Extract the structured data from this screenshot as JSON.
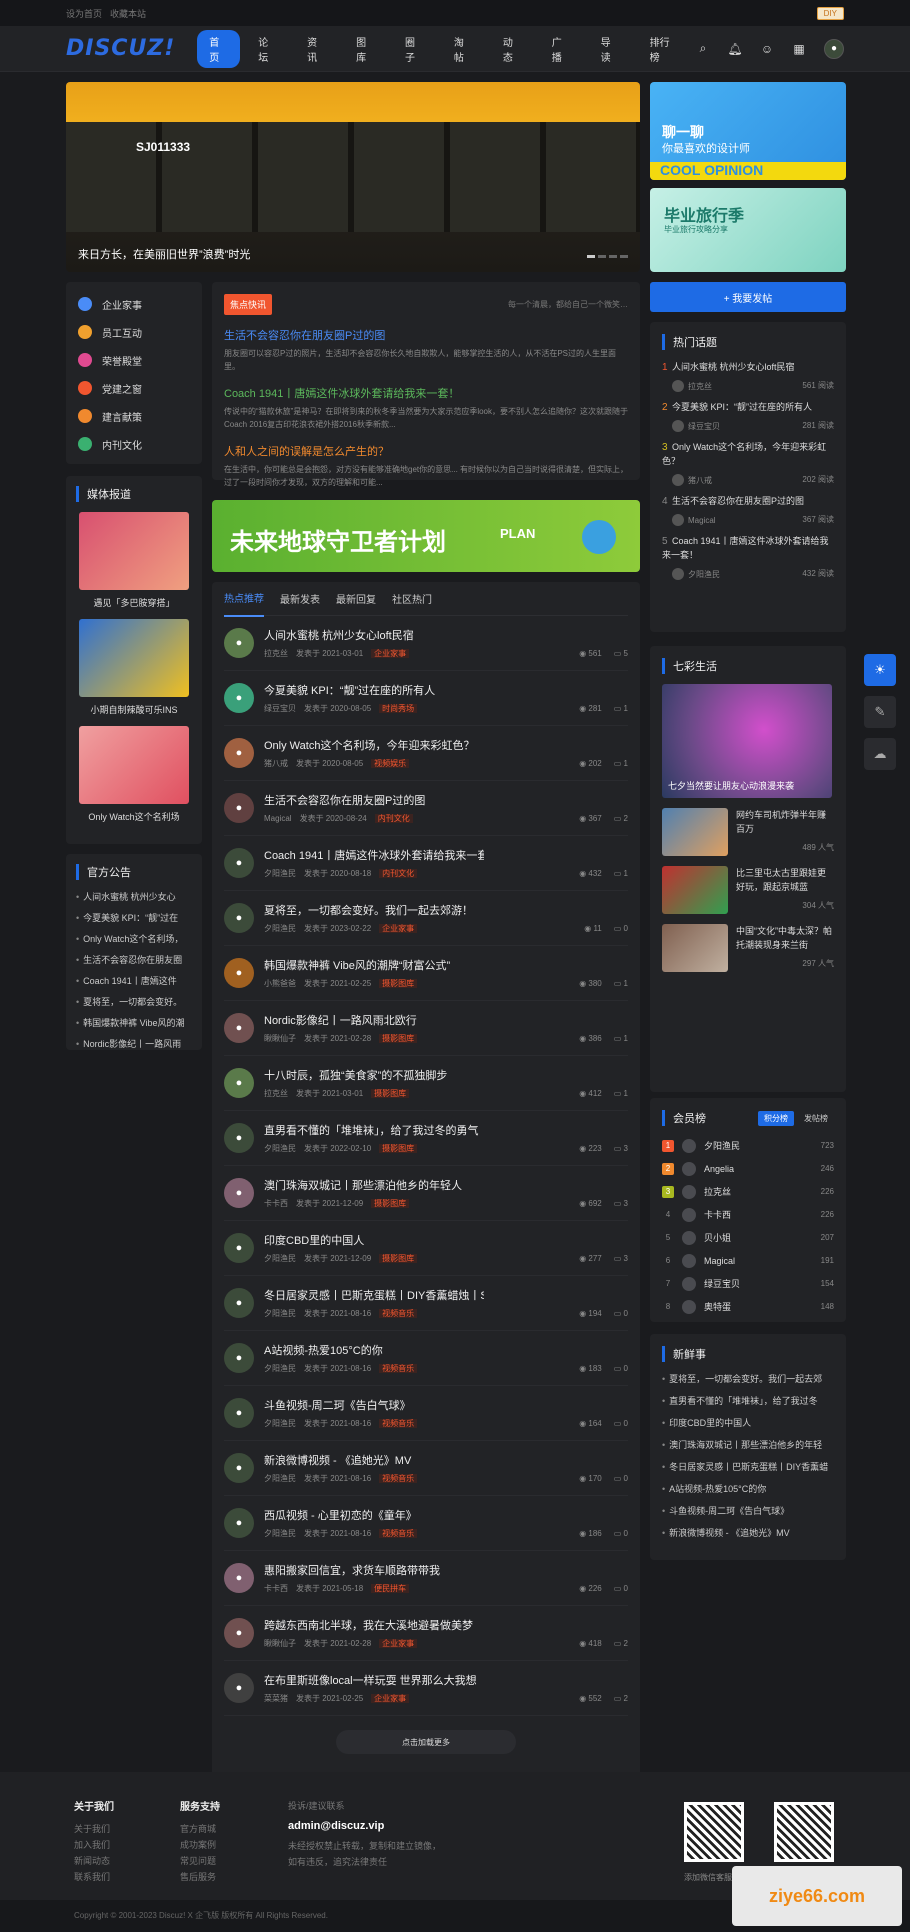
{
  "topbar": {
    "home": "设为首页",
    "fav": "收藏本站",
    "diy": "DIY"
  },
  "nav": {
    "logo": "DISCUZ!",
    "items": [
      "首页",
      "论坛",
      "资讯",
      "图库",
      "圈子",
      "淘帖",
      "动态",
      "广播",
      "导读",
      "排行榜"
    ]
  },
  "slider": {
    "plate": "SJ011333",
    "caption": "来日方长，在美丽旧世界”浪费”时光"
  },
  "ads": {
    "ad1_t1": "聊一聊",
    "ad1_t2": "你最喜欢的设计师",
    "ad1_t3": "COOL OPINION",
    "ad2_t1": "毕业旅行季",
    "ad2_t2": "毕业旅行攻略分享"
  },
  "cats": [
    "企业家事",
    "员工互动",
    "荣誉殿堂",
    "党建之窗",
    "建言献策",
    "内刊文化"
  ],
  "hot": {
    "badge": "焦点快讯",
    "right": "每一个清晨，都给自己一个微笑…",
    "items": [
      {
        "t": "生活不会容忍你在朋友圈P过的图",
        "d": "朋友圈可以容忍P过的照片，生活却不会容忍你长久地自欺欺人，能够掌控生活的人，从不活在PS过的人生里面里。",
        "c": "#4a8cf7"
      },
      {
        "t": "Coach 1941丨唐嫣这件冰球外套请给我来一套！",
        "d": "传说中的“猫款休旅”是神马？在即将到来的秋冬季当然要为大家示范应季look，要不别人怎么追随你？这次就跟随于Coach 2016复古印花浪衣裙外搭2016秋季新款...",
        "c": "#5cb85c"
      },
      {
        "t": "人和人之间的误解是怎么产生的？",
        "d": "在生活中，你可能总是会抱怨，对方没有能够准确地get你的意思... 有时候你以为自己当时说得很清楚，但实际上，过了一段时间你才发现，双方的理解和可能...",
        "c": "#f0892e"
      }
    ]
  },
  "media": {
    "title": "媒体报道",
    "items": [
      "遇见「多巴胺穿搭」",
      "小期自制辣酸可乐INS",
      "Only Watch这个名利场"
    ]
  },
  "banner": {
    "t": "未来地球守卫者计划",
    "s": "PLAN"
  },
  "notice": {
    "title": "官方公告",
    "items": [
      "人间水蜜桃 杭州少女心",
      "今夏美貌 KPI：“靓”过在",
      "Only Watch这个名利场，",
      "生活不会容忍你在朋友圈",
      "Coach 1941丨唐嫣这件",
      "夏将至，一切都会变好。",
      "韩国爆款神裤 Vibe风的潮",
      "Nordic影像纪丨一路风雨"
    ]
  },
  "tabs": [
    "热点推荐",
    "最新发表",
    "最新回复",
    "社区热门"
  ],
  "threads": [
    {
      "t": "人间水蜜桃 杭州少女心loft民宿",
      "u": "拉克丝",
      "d": "发表于 2021-03-01",
      "tag": "企业家事",
      "v": "561",
      "r": "5",
      "c": "#5a7a4a"
    },
    {
      "t": "今夏美貌 KPI：“靓”过在座的所有人",
      "u": "绿豆宝贝",
      "d": "发表于 2020-08-05",
      "tag": "时尚秀场",
      "v": "281",
      "r": "1",
      "c": "#3aa07a"
    },
    {
      "t": "Only Watch这个名利场，今年迎来彩虹色？",
      "u": "猪八戒",
      "d": "发表于 2020-08-05",
      "tag": "视频娱乐",
      "v": "202",
      "r": "1",
      "c": "#a06040"
    },
    {
      "t": "生活不会容忍你在朋友圈P过的图",
      "u": "Magical",
      "d": "发表于 2020-08-24",
      "tag": "内刊文化",
      "v": "367",
      "r": "2",
      "c": "#604040"
    },
    {
      "t": "Coach 1941丨唐嫣这件冰球外套请给我来一套",
      "u": "夕阳渔民",
      "d": "发表于 2020-08-18",
      "tag": "内刊文化",
      "v": "432",
      "r": "1",
      "c": "#3c4b3a"
    },
    {
      "t": "夏将至，一切都会变好。我们一起去郊游！",
      "u": "夕阳渔民",
      "d": "发表于 2023-02-22",
      "tag": "企业家事",
      "v": "11",
      "r": "0",
      "c": "#3c4b3a"
    },
    {
      "t": "韩国爆款神裤 Vibe风的潮牌“财富公式”",
      "u": "小熊爸爸",
      "d": "发表于 2021-02-25",
      "tag": "摄影图库",
      "v": "380",
      "r": "1",
      "c": "#a06020"
    },
    {
      "t": "Nordic影像纪丨一路风雨北欧行",
      "u": "瞅瞅仙子",
      "d": "发表于 2021-02-28",
      "tag": "摄影图库",
      "v": "386",
      "r": "1",
      "c": "#705050"
    },
    {
      "t": "十八时辰，孤独“美食家”的不孤独脚步",
      "u": "拉克丝",
      "d": "发表于 2021-03-01",
      "tag": "摄影图库",
      "v": "412",
      "r": "1",
      "c": "#5a7a4a"
    },
    {
      "t": "直男看不懂的「堆堆袜」，给了我过冬的勇气",
      "u": "夕阳渔民",
      "d": "发表于 2022-02-10",
      "tag": "摄影图库",
      "v": "223",
      "r": "3",
      "c": "#3c4b3a"
    },
    {
      "t": "澳门珠海双城记丨那些漂泊他乡的年轻人",
      "u": "卡卡西",
      "d": "发表于 2021-12-09",
      "tag": "摄影图库",
      "v": "692",
      "r": "3",
      "c": "#806070"
    },
    {
      "t": "印度CBD里的中国人",
      "u": "夕阳渔民",
      "d": "发表于 2021-12-09",
      "tag": "摄影图库",
      "v": "277",
      "r": "3",
      "c": "#3c4b3a"
    },
    {
      "t": "冬日居家灵感丨巴斯克蛋糕丨DIY香薰蜡烛丨S",
      "u": "夕阳渔民",
      "d": "发表于 2021-08-16",
      "tag": "视频音乐",
      "v": "194",
      "r": "0",
      "c": "#3c4b3a"
    },
    {
      "t": "A站视频-热爱105°C的你",
      "u": "夕阳渔民",
      "d": "发表于 2021-08-16",
      "tag": "视频音乐",
      "v": "183",
      "r": "0",
      "c": "#3c4b3a"
    },
    {
      "t": "斗鱼视频-周二珂《告白气球》",
      "u": "夕阳渔民",
      "d": "发表于 2021-08-16",
      "tag": "视频音乐",
      "v": "164",
      "r": "0",
      "c": "#3c4b3a"
    },
    {
      "t": "新浪微博视频 - 《追她光》MV",
      "u": "夕阳渔民",
      "d": "发表于 2021-08-16",
      "tag": "视频音乐",
      "v": "170",
      "r": "0",
      "c": "#3c4b3a"
    },
    {
      "t": "西瓜视频 - 心里初恋的《童年》",
      "u": "夕阳渔民",
      "d": "发表于 2021-08-16",
      "tag": "视频音乐",
      "v": "186",
      "r": "0",
      "c": "#3c4b3a"
    },
    {
      "t": "惠阳搬家回信宜，求货车顺路带带我",
      "u": "卡卡西",
      "d": "发表于 2021-05-18",
      "tag": "便民拼车",
      "v": "226",
      "r": "0",
      "c": "#806070"
    },
    {
      "t": "跨越东西南北半球，我在大溪地避暑做美梦",
      "u": "瞅瞅仙子",
      "d": "发表于 2021-02-28",
      "tag": "企业家事",
      "v": "418",
      "r": "2",
      "c": "#705050"
    },
    {
      "t": "在布里斯班像local一样玩耍 世界那么大我想",
      "u": "菜菜猪",
      "d": "发表于 2021-02-25",
      "tag": "企业家事",
      "v": "552",
      "r": "2",
      "c": "#404040"
    }
  ],
  "more": "点击加载更多",
  "post": "+ 我要发帖",
  "hottopic": {
    "title": "热门话题",
    "items": [
      {
        "n": "1",
        "t": "人间水蜜桃 杭州少女心loft民宿",
        "u": "拉克丝",
        "v": "561 阅读",
        "c": "#f1562f"
      },
      {
        "n": "2",
        "t": "今夏美貌 KPI：“靓”过在座的所有人",
        "u": "绿豆宝贝",
        "v": "281 阅读",
        "c": "#f0892e"
      },
      {
        "n": "3",
        "t": "Only Watch这个名利场，今年迎来彩虹色？",
        "u": "猪八戒",
        "v": "202 阅读",
        "c": "#d5c020"
      },
      {
        "n": "4",
        "t": "生活不会容忍你在朋友圈P过的图",
        "u": "Magical",
        "v": "367 阅读",
        "c": "#888"
      },
      {
        "n": "5",
        "t": "Coach 1941丨唐嫣这件冰球外套请给我来一套！",
        "u": "夕阳渔民",
        "v": "432 阅读",
        "c": "#888"
      }
    ]
  },
  "life": {
    "title": "七彩生活",
    "big": "七夕当然要让朋友心动浪漫来袭",
    "items": [
      {
        "t": "网约车司机炸弹半年赚百万",
        "p": "489 人气"
      },
      {
        "t": "比三里屯太古里跟娃更好玩，跟起京城蓝",
        "p": "304 人气"
      },
      {
        "t": "中国“文化”中毒太深？帕托潮装现身来兰街",
        "p": "297 人气"
      }
    ]
  },
  "rank": {
    "title": "会员榜",
    "b1": "积分榜",
    "b2": "发帖榜",
    "items": [
      {
        "n": "1",
        "u": "夕阳渔民",
        "v": "723",
        "c": "#f1562f"
      },
      {
        "n": "2",
        "u": "Angelia",
        "v": "246",
        "c": "#f0892e"
      },
      {
        "n": "3",
        "u": "拉克丝",
        "v": "226",
        "c": "#a8b820"
      },
      {
        "n": "4",
        "u": "卡卡西",
        "v": "226",
        "c": ""
      },
      {
        "n": "5",
        "u": "贝小姐",
        "v": "207",
        "c": ""
      },
      {
        "n": "6",
        "u": "Magical",
        "v": "191",
        "c": ""
      },
      {
        "n": "7",
        "u": "绿豆宝贝",
        "v": "154",
        "c": ""
      },
      {
        "n": "8",
        "u": "奥特蛋",
        "v": "148",
        "c": ""
      }
    ]
  },
  "fresh": {
    "title": "新鲜事",
    "items": [
      "夏将至，一切都会变好。我们一起去郊",
      "直男看不懂的「堆堆袜」，给了我过冬",
      "印度CBD里的中国人",
      "澳门珠海双城记丨那些漂泊他乡的年轻",
      "冬日居家灵感丨巴斯克蛋糕丨DIY香薰蜡",
      "A站视频-热爱105°C的你",
      "斗鱼视频-周二珂《告白气球》",
      "新浪微博视频 - 《追她光》MV"
    ]
  },
  "footer": {
    "c1": "关于我们",
    "c1i": [
      "关于我们",
      "加入我们",
      "新闻动态",
      "联系我们"
    ],
    "c2": "服务支持",
    "c2i": [
      "官方商城",
      "成功案例",
      "常见问题",
      "售后服务"
    ],
    "c3": "投诉/建议联系",
    "email": "admin@discuz.vip",
    "note1": "未经授权禁止转载，复制和建立镜像，",
    "note2": "如有违反，追究法律责任",
    "qr1": "添加微信客服",
    "qr2": "",
    "copy": "Copyright © 2001-2023 Discuz! X 企飞版 版权所有 All Rights Reserved."
  },
  "watermark": "ziye66.com"
}
